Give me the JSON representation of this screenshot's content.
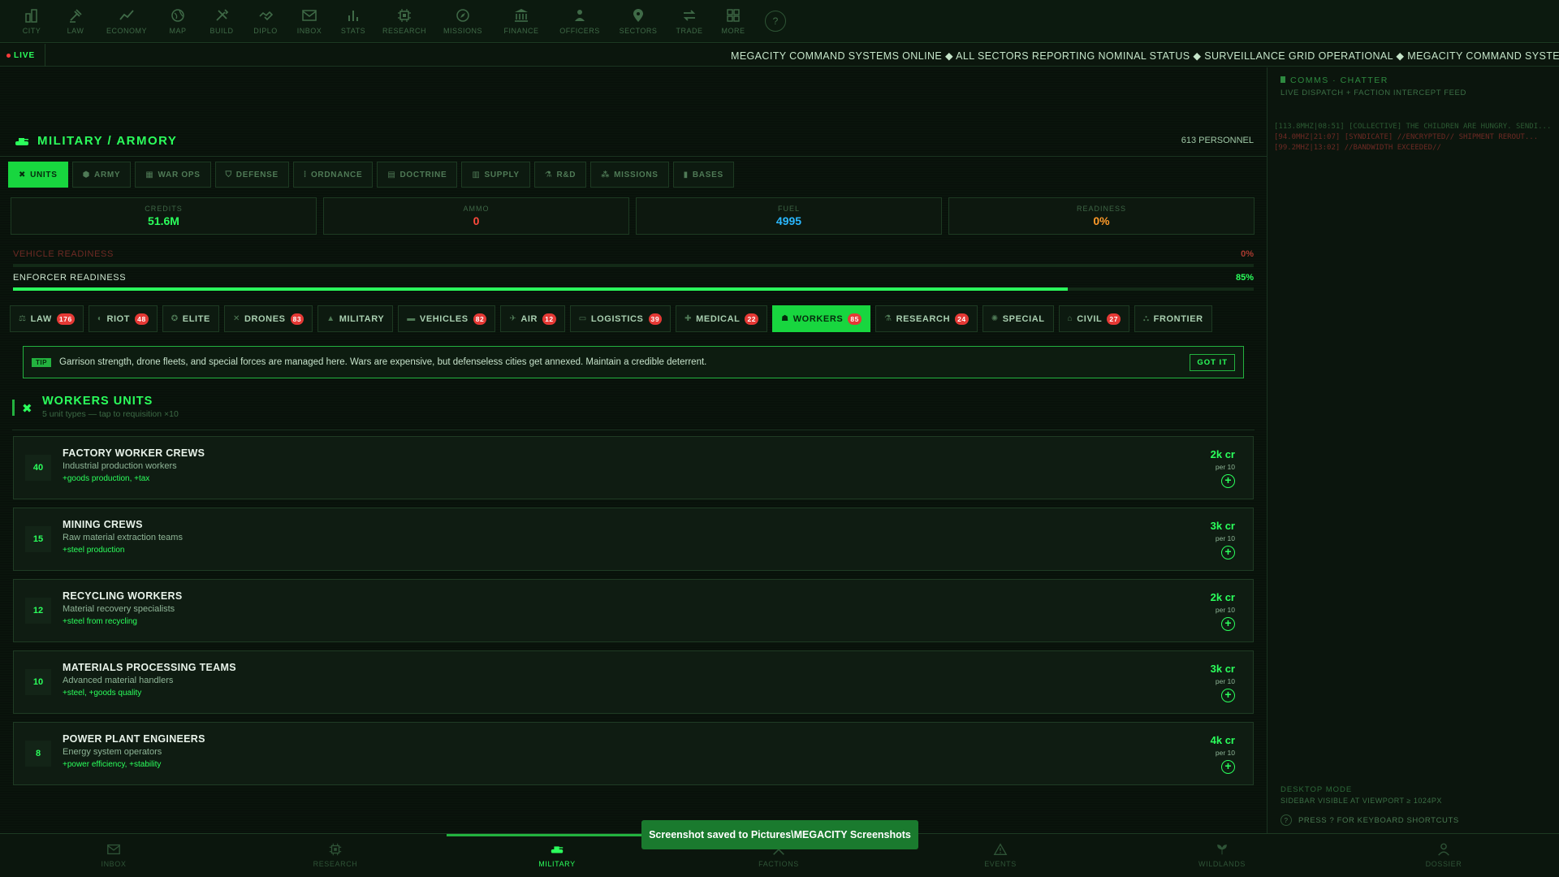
{
  "topnav": {
    "items": [
      {
        "label": "CITY",
        "icon": "city-icon"
      },
      {
        "label": "LAW",
        "icon": "gavel-icon"
      },
      {
        "label": "ECONOMY",
        "icon": "trend-icon"
      },
      {
        "label": "MAP",
        "icon": "globe-icon"
      },
      {
        "label": "BUILD",
        "icon": "tools-icon"
      },
      {
        "label": "DIPLO",
        "icon": "handshake-icon"
      },
      {
        "label": "INBOX",
        "icon": "mail-icon"
      },
      {
        "label": "STATS",
        "icon": "bar-chart-icon"
      },
      {
        "label": "RESEARCH",
        "icon": "chip-icon"
      },
      {
        "label": "MISSIONS",
        "icon": "compass-icon"
      },
      {
        "label": "FINANCE",
        "icon": "bank-icon"
      },
      {
        "label": "OFFICERS",
        "icon": "officer-icon"
      },
      {
        "label": "SECTORS",
        "icon": "map-pin-icon"
      },
      {
        "label": "TRADE",
        "icon": "swap-icon"
      },
      {
        "label": "MORE",
        "icon": "grid-icon"
      }
    ],
    "help_label": "?"
  },
  "ticker": {
    "live_label": "LIVE",
    "text": "MEGACITY COMMAND SYSTEMS ONLINE ◆ ALL SECTORS REPORTING NOMINAL STATUS ◆ SURVEILLANCE GRID OPERATIONAL ◆ MEGACITY COMMAND SYSTEMS ONLINE ◆"
  },
  "sidebar": {
    "title": "COMMS · CHATTER",
    "subtitle": "LIVE DISPATCH + FACTION INTERCEPT FEED",
    "chatter": [
      {
        "text": "[113.8MHZ|08:51] [COLLECTIVE] THE CHILDREN ARE HUNGRY. SENDI...",
        "tone": "green"
      },
      {
        "text": "[94.0MHZ|21:07] [SYNDICATE] //ENCRYPTED// SHIPMENT REROUT...",
        "tone": "red"
      },
      {
        "text": "[99.2MHZ|13:02] //BANDWIDTH EXCEEDED//",
        "tone": "red"
      }
    ],
    "desktop_mode": "DESKTOP MODE",
    "desktop_note": "SIDEBAR VISIBLE AT VIEWPORT ≥ 1024PX",
    "shortcut_note": "PRESS ? FOR KEYBOARD SHORTCUTS"
  },
  "main": {
    "title": "MILITARY / ARMORY",
    "personnel": "613 PERSONNEL",
    "section_tabs": [
      {
        "label": "UNITS",
        "icon": "✖",
        "active": true
      },
      {
        "label": "ARMY",
        "icon": "⬢",
        "active": false
      },
      {
        "label": "WAR OPS",
        "icon": "▦",
        "active": false
      },
      {
        "label": "DEFENSE",
        "icon": "⛉",
        "active": false
      },
      {
        "label": "ORDNANCE",
        "icon": "⁞",
        "active": false
      },
      {
        "label": "DOCTRINE",
        "icon": "▤",
        "active": false
      },
      {
        "label": "SUPPLY",
        "icon": "▥",
        "active": false
      },
      {
        "label": "R&D",
        "icon": "⚗",
        "active": false
      },
      {
        "label": "MISSIONS",
        "icon": "⁂",
        "active": false
      },
      {
        "label": "BASES",
        "icon": "▮",
        "active": false
      }
    ],
    "stats": [
      {
        "label": "CREDITS",
        "value": "51.6M",
        "color": "#2bff5c"
      },
      {
        "label": "AMMO",
        "value": "0",
        "color": "#ff4a3d"
      },
      {
        "label": "FUEL",
        "value": "4995",
        "color": "#2ab8ff"
      },
      {
        "label": "READINESS",
        "value": "0%",
        "color": "#ff9a2a"
      }
    ],
    "vehicle_readiness": {
      "label": "VEHICLE READINESS",
      "pct_label": "0%",
      "value": 0
    },
    "enforcer_readiness": {
      "label": "ENFORCER READINESS",
      "pct_label": "85%",
      "value": 0.85
    },
    "category_tabs": [
      {
        "label": "LAW",
        "icon": "⚖",
        "badge": "176",
        "active": false
      },
      {
        "label": "RIOT",
        "icon": "◐",
        "badge": "48",
        "active": false
      },
      {
        "label": "ELITE",
        "icon": "✪",
        "badge": "",
        "active": false
      },
      {
        "label": "DRONES",
        "icon": "✕",
        "badge": "83",
        "active": false
      },
      {
        "label": "MILITARY",
        "icon": "▲",
        "badge": "",
        "active": false
      },
      {
        "label": "VEHICLES",
        "icon": "▬",
        "badge": "82",
        "active": false
      },
      {
        "label": "AIR",
        "icon": "✈",
        "badge": "12",
        "active": false
      },
      {
        "label": "LOGISTICS",
        "icon": "▭",
        "badge": "39",
        "active": false
      },
      {
        "label": "MEDICAL",
        "icon": "✚",
        "badge": "22",
        "active": false
      },
      {
        "label": "WORKERS",
        "icon": "☗",
        "badge": "85",
        "active": true
      },
      {
        "label": "RESEARCH",
        "icon": "⚗",
        "badge": "24",
        "active": false
      },
      {
        "label": "SPECIAL",
        "icon": "✺",
        "badge": "",
        "active": false
      },
      {
        "label": "CIVIL",
        "icon": "⌂",
        "badge": "27",
        "active": false
      },
      {
        "label": "FRONTIER",
        "icon": "⛬",
        "badge": "",
        "active": false
      }
    ],
    "tip": {
      "badge": "TIP",
      "text": "Garrison strength, drone fleets, and special forces are managed here. Wars are expensive, but defenseless cities get annexed. Maintain a credible deterrent.",
      "button": "GOT IT"
    },
    "workers": {
      "title": "WORKERS UNITS",
      "subtitle": "5 unit types — tap to requisition ×10",
      "units": [
        {
          "count": "40",
          "name": "FACTORY WORKER CREWS",
          "desc": "Industrial production workers",
          "bonus": "+goods production, +tax",
          "cost": "2k cr",
          "per": "per 10"
        },
        {
          "count": "15",
          "name": "MINING CREWS",
          "desc": "Raw material extraction teams",
          "bonus": "+steel production",
          "cost": "3k cr",
          "per": "per 10"
        },
        {
          "count": "12",
          "name": "RECYCLING WORKERS",
          "desc": "Material recovery specialists",
          "bonus": "+steel from recycling",
          "cost": "2k cr",
          "per": "per 10"
        },
        {
          "count": "10",
          "name": "MATERIALS PROCESSING TEAMS",
          "desc": "Advanced material handlers",
          "bonus": "+steel, +goods quality",
          "cost": "3k cr",
          "per": "per 10"
        },
        {
          "count": "8",
          "name": "POWER PLANT ENGINEERS",
          "desc": "Energy system operators",
          "bonus": "+power efficiency, +stability",
          "cost": "4k cr",
          "per": "per 10"
        }
      ]
    }
  },
  "bottomnav": {
    "items": [
      {
        "label": "INBOX",
        "icon": "mail-icon",
        "active": false
      },
      {
        "label": "RESEARCH",
        "icon": "chip-icon",
        "active": false
      },
      {
        "label": "MILITARY",
        "icon": "tank-icon",
        "active": true
      },
      {
        "label": "FACTIONS",
        "icon": "swords-icon",
        "active": false
      },
      {
        "label": "EVENTS",
        "icon": "warning-icon",
        "active": false
      },
      {
        "label": "WILDLANDS",
        "icon": "leaf-icon",
        "active": false
      },
      {
        "label": "DOSSIER",
        "icon": "user-icon",
        "active": false
      }
    ]
  },
  "toast": "Screenshot saved to Pictures\\MEGACITY Screenshots"
}
